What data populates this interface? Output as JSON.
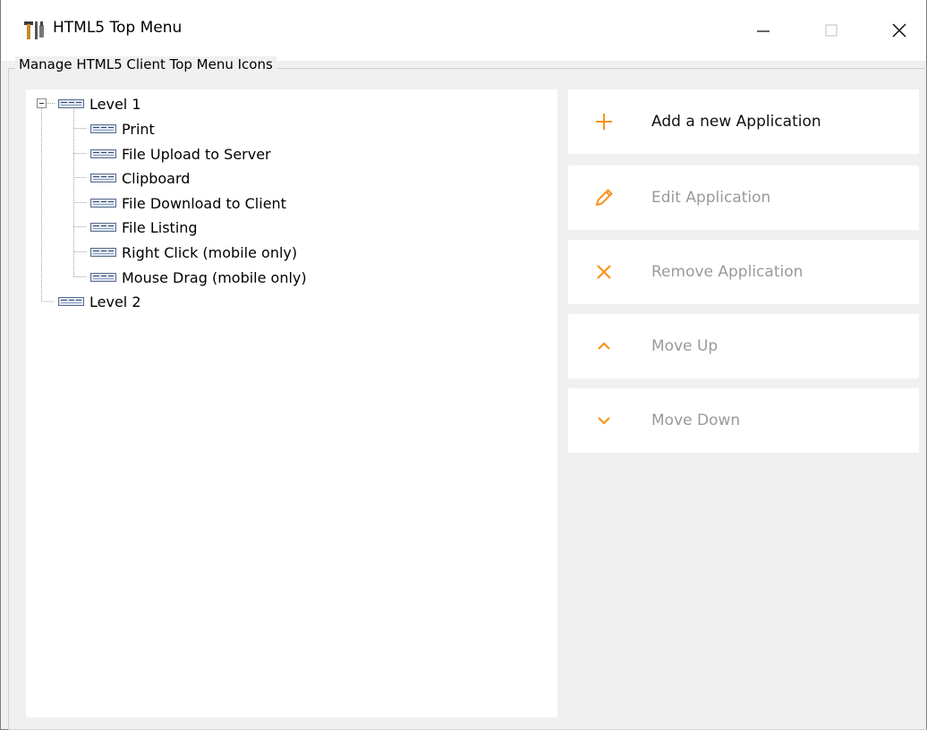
{
  "window": {
    "title": "HTML5 Top Menu",
    "controls": {
      "minimize": "minimize",
      "maximize": "maximize",
      "close": "close"
    }
  },
  "group": {
    "legend": "Manage HTML5 Client Top Menu Icons"
  },
  "tree": {
    "level1": {
      "label": "Level 1",
      "expanded": true,
      "children": [
        "Print",
        "File Upload to Server",
        "Clipboard",
        "File Download to Client",
        "File Listing",
        "Right Click (mobile only)",
        "Mouse Drag (mobile only)"
      ]
    },
    "level2": {
      "label": "Level 2"
    }
  },
  "actions": {
    "add": {
      "label": "Add a new Application",
      "enabled": true,
      "icon": "plus-icon"
    },
    "edit": {
      "label": "Edit Application",
      "enabled": false,
      "icon": "pencil-icon"
    },
    "remove": {
      "label": "Remove Application",
      "enabled": false,
      "icon": "x-icon"
    },
    "move_up": {
      "label": "Move Up",
      "enabled": false,
      "icon": "chevron-up-icon"
    },
    "move_down": {
      "label": "Move Down",
      "enabled": false,
      "icon": "chevron-down-icon"
    }
  },
  "colors": {
    "accent": "#f7941d",
    "disabled_text": "#9a9a9a",
    "panel_bg": "#f0f0f0"
  }
}
